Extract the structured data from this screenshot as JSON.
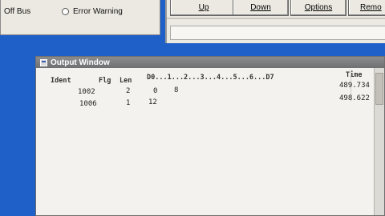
{
  "status_panel": {
    "items": [
      {
        "label": "Off Bus"
      },
      {
        "label": "Error Warning"
      }
    ]
  },
  "toolbar": {
    "buttons": [
      {
        "label": "Up"
      },
      {
        "label": "Down"
      },
      {
        "label": "Options"
      },
      {
        "label": "Remo"
      }
    ]
  },
  "output_window": {
    "title": "Output Window",
    "headers": {
      "ident": "Ident",
      "flg": "Flg",
      "len": "Len",
      "data": "D0...1...2...3...4...5...6...D7",
      "time": "Time"
    },
    "rows": [
      {
        "ident": "1002",
        "flg": "2",
        "len": "0",
        "data": "8",
        "time": "489.734"
      },
      {
        "ident": "1006",
        "flg": "1",
        "len": "12",
        "data": "",
        "time": "498.622"
      }
    ]
  }
}
